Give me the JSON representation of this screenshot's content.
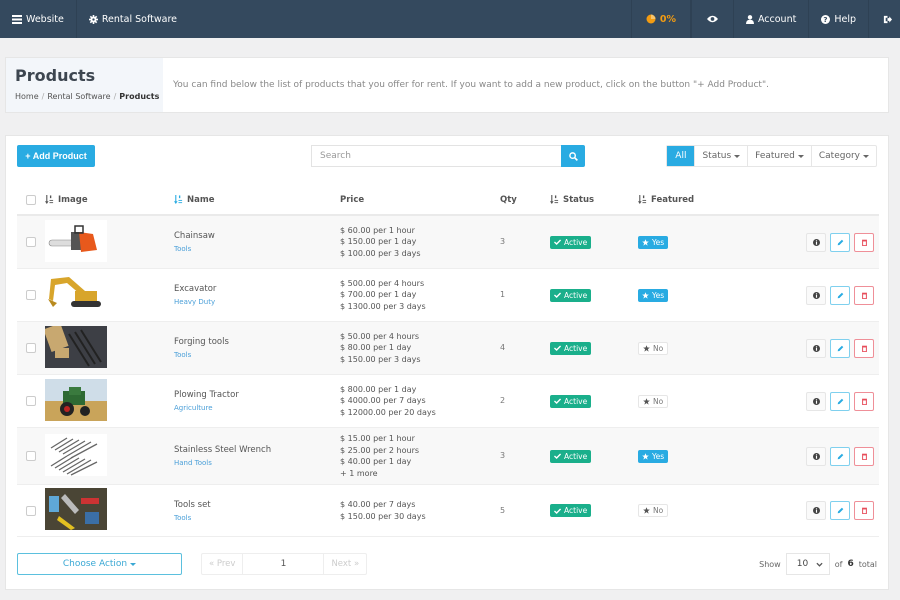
{
  "topnav": {
    "website": "Website",
    "rental_software": "Rental Software",
    "progress": "0%",
    "account": "Account",
    "help": "Help"
  },
  "header": {
    "title": "Products",
    "breadcrumb": [
      "Home",
      "Rental Software",
      "Products"
    ],
    "description": "You can find below the list of products that you offer for rent. If you want to add a new product, click on the button \"+ Add Product\"."
  },
  "toolbar": {
    "add_label": "+ Add Product",
    "search_placeholder": "Search",
    "filters": [
      "All",
      "Status",
      "Featured",
      "Category"
    ]
  },
  "table": {
    "headers": {
      "image": "Image",
      "name": "Name",
      "price": "Price",
      "qty": "Qty",
      "status": "Status",
      "featured": "Featured"
    },
    "rows": [
      {
        "name": "Chainsaw",
        "category": "Tools",
        "prices": [
          "$ 60.00 per 1 hour",
          "$ 150.00 per 1 day",
          "$ 100.00 per 3 days"
        ],
        "qty": "3",
        "status": "Active",
        "featured": "Yes",
        "image": "chainsaw"
      },
      {
        "name": "Excavator",
        "category": "Heavy Duty",
        "prices": [
          "$ 500.00 per 4 hours",
          "$ 700.00 per 1 day",
          "$ 1300.00 per 3 days"
        ],
        "qty": "1",
        "status": "Active",
        "featured": "Yes",
        "image": "excavator"
      },
      {
        "name": "Forging tools",
        "category": "Tools",
        "prices": [
          "$ 50.00 per 4 hours",
          "$ 80.00 per 1 day",
          "$ 150.00 per 3 days"
        ],
        "qty": "4",
        "status": "Active",
        "featured": "No",
        "image": "forging"
      },
      {
        "name": "Plowing Tractor",
        "category": "Agriculture",
        "prices": [
          "$ 800.00 per 1 day",
          "$ 4000.00 per 7 days",
          "$ 12000.00 per 20 days"
        ],
        "qty": "2",
        "status": "Active",
        "featured": "No",
        "image": "tractor"
      },
      {
        "name": "Stainless Steel Wrench",
        "category": "Hand Tools",
        "prices": [
          "$ 15.00 per 1 hour",
          "$ 25.00 per 2 hours",
          "$ 40.00 per 1 day",
          "+ 1 more"
        ],
        "qty": "3",
        "status": "Active",
        "featured": "Yes",
        "image": "wrench"
      },
      {
        "name": "Tools set",
        "category": "Tools",
        "prices": [
          "$ 40.00 per 7 days",
          "$ 150.00 per 30 days"
        ],
        "qty": "5",
        "status": "Active",
        "featured": "No",
        "image": "toolset"
      }
    ]
  },
  "footer": {
    "choose_action": "Choose Action",
    "prev": "« Prev",
    "page": "1",
    "next": "Next »",
    "show_label": "Show",
    "page_size": "10",
    "of_label": "of",
    "total": "6",
    "total_label": "total"
  },
  "colors": {
    "nav_bg": "#34495e",
    "primary": "#29abe2",
    "success": "#1aaf8b",
    "danger": "#e74c5a",
    "progress": "#f39c12"
  }
}
